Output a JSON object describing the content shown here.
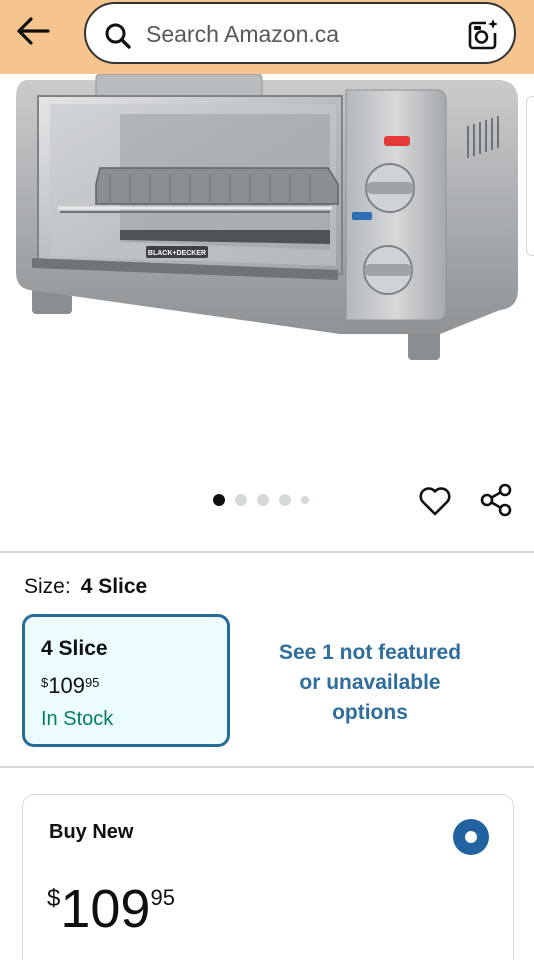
{
  "header": {
    "search_placeholder": "Search Amazon.ca",
    "icons": [
      "back-arrow-icon",
      "search-icon",
      "camera-search-icon"
    ]
  },
  "gallery": {
    "brand_label": "BLACK+DECKER",
    "image_count": 5,
    "active_index": 0,
    "icons": [
      "heart-icon",
      "share-icon"
    ]
  },
  "size": {
    "label": "Size:",
    "selected": "4 Slice"
  },
  "option_card": {
    "title": "4 Slice",
    "currency": "$",
    "price_whole": "109",
    "price_fraction": "95",
    "stock": "In Stock"
  },
  "see_more": {
    "line1": "See 1 not featured",
    "line2": "or unavailable",
    "line3": "options"
  },
  "buy_new": {
    "title": "Buy New",
    "currency": "$",
    "price_whole": "109",
    "price_fraction": "95",
    "selected": true
  },
  "colors": {
    "header_bg": "#f6c48e",
    "accent_blue": "#276c97",
    "link_blue": "#2e6d9c",
    "in_stock_green": "#067d62",
    "radio_blue": "#2162a1"
  }
}
